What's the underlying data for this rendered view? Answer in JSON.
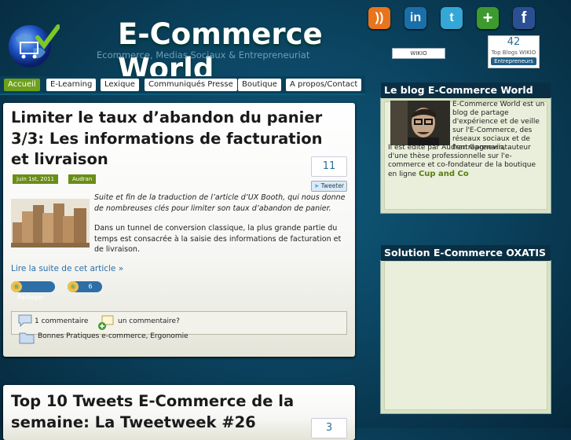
{
  "header": {
    "title": "E-Commerce World",
    "tagline": "Ecommerce, Medias Sociaux & Entrepreneuriat",
    "wikio_label": "WIKIO",
    "wikio_rank": {
      "number": "42",
      "label": "Top Blogs WIKIO",
      "category": "Entrepreneurs"
    }
  },
  "social": [
    {
      "name": "rss-icon",
      "glyph": "))",
      "color": "#e8741c"
    },
    {
      "name": "linkedin-icon",
      "glyph": "in",
      "color": "#1a6fa8"
    },
    {
      "name": "twitter-icon",
      "glyph": "t",
      "color": "#34a7d6"
    },
    {
      "name": "add-icon",
      "glyph": "+",
      "color": "#3c9a2e"
    },
    {
      "name": "facebook-icon",
      "glyph": "f",
      "color": "#2a4f93"
    }
  ],
  "nav": [
    {
      "label": "Accueil",
      "active": true
    },
    {
      "label": "E-Learning"
    },
    {
      "label": "Lexique"
    },
    {
      "label": "Communiqués Presse"
    },
    {
      "label": "Boutique"
    },
    {
      "label": "A propos/Contact"
    }
  ],
  "post1": {
    "title": "Limiter le taux d’abandon du panier 3/3: Les informations de facturation et livraison",
    "tweet_count": "11",
    "tweet_label": "Tweeter",
    "date": "juin 1st, 2011",
    "author": "Audran",
    "excerpt": "Suite et fin de la traduction de l’article d’UX Booth, qui nous donne de nombreuses clés pour limiter son taux d’abandon de panier.",
    "body": "Dans un tunnel de conversion classique, la plus grande partie du temps est consacrée à la saisie des informations de facturation et de livraison.",
    "read_more": "Lire la suite de cet article »",
    "share_label": "Partager",
    "share_count": "6",
    "comment_count": "1 commentaire",
    "add_comment": "un commentaire?",
    "category1": "Bonnes Pratiques e-commerce",
    "category_sep": ",",
    "category2": "Ergonomie"
  },
  "post2": {
    "title": "Top 10 Tweets E-Commerce de la semaine: La Tweetweek #26",
    "tweet_count": "3"
  },
  "sidebar": {
    "blog_widget": {
      "title": "Le blog E-Commerce World",
      "intro": "E-Commerce World est un blog de partage d'expérience et de veille sur l'E-Commerce, des réseaux sociaux et de l'entreprenariat.",
      "intro2": "Il est édité par Audran Gagnevin, auteur d'une thèse professionnelle sur l'e-commerce et co-fondateur de la boutique en ligne",
      "shop_link": "Cup and Co"
    },
    "oxatis_widget": {
      "title": "Solution E-Commerce OXATIS"
    }
  }
}
